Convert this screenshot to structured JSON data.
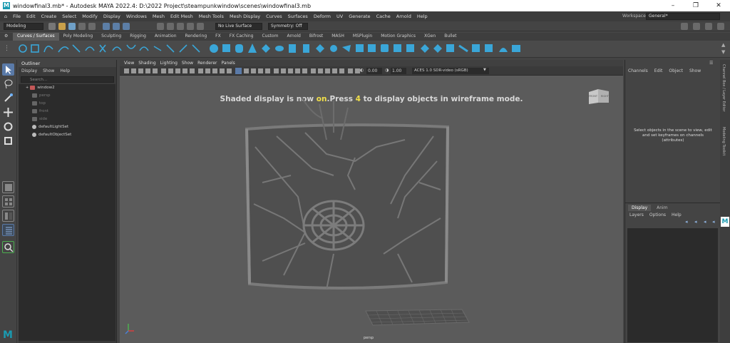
{
  "window": {
    "title": "windowfinal3.mb* - Autodesk MAYA 2022.4: D:\\2022 Project\\steampunkwindow\\scenes\\windowfinal3.mb",
    "minimize": "–",
    "maximize": "❐",
    "close": "✕"
  },
  "menubar": {
    "items": [
      "File",
      "Edit",
      "Create",
      "Select",
      "Modify",
      "Display",
      "Windows",
      "Mesh",
      "Edit Mesh",
      "Mesh Tools",
      "Mesh Display",
      "Curves",
      "Surfaces",
      "Deform",
      "UV",
      "Generate",
      "Cache",
      "Arnold",
      "Help"
    ],
    "workspace_label": "Workspace:",
    "workspace_value": "General*"
  },
  "statusline": {
    "menuset": "Modeling",
    "live_surface": "No Live Surface",
    "symmetry": "Symmetry: Off"
  },
  "shelf": {
    "tabs": [
      "Curves / Surfaces",
      "Poly Modeling",
      "Sculpting",
      "Rigging",
      "Animation",
      "Rendering",
      "FX",
      "FX Caching",
      "Custom",
      "Arnold",
      "Bifrost",
      "MASH",
      "MSPlugin",
      "Motion Graphics",
      "XGen",
      "Bullet"
    ],
    "active_tab": "Curves / Surfaces"
  },
  "outliner": {
    "title": "Outliner",
    "menu": [
      "Display",
      "Show",
      "Help"
    ],
    "search_placeholder": "Search...",
    "items": [
      "window2",
      "persp",
      "top",
      "front",
      "side",
      "defaultLightSet",
      "defaultObjectSet"
    ]
  },
  "viewport": {
    "menu": [
      "View",
      "Shading",
      "Lighting",
      "Show",
      "Renderer",
      "Panels"
    ],
    "exposure": "0.00",
    "gamma": "1.00",
    "colorspace": "ACES 1.0 SDR-video (sRGB)",
    "message_before": "Shaded display is now ",
    "message_on": "on",
    "message_middle": ".Press ",
    "message_key": "4",
    "message_after": " to display objects in wireframe mode.",
    "camera_label": "persp",
    "viewcube_front": "FRONT",
    "viewcube_right": "RIGHT"
  },
  "channelbox": {
    "menu": [
      "Channels",
      "Edit",
      "Object",
      "Show"
    ],
    "info": "Select objects in the scene to view, edit and set keyframes on channels (attributes)"
  },
  "layers": {
    "tabs": [
      "Display",
      "Anim"
    ],
    "menu": [
      "Layers",
      "Options",
      "Help"
    ]
  },
  "sidetabs": [
    "Channel Box / Layer Editor",
    "Modeling Toolkit"
  ],
  "colors": {
    "accent": "#1a9ab0",
    "message_highlight": "#f2e04a",
    "shelf_icon": "#3aa6d8"
  }
}
